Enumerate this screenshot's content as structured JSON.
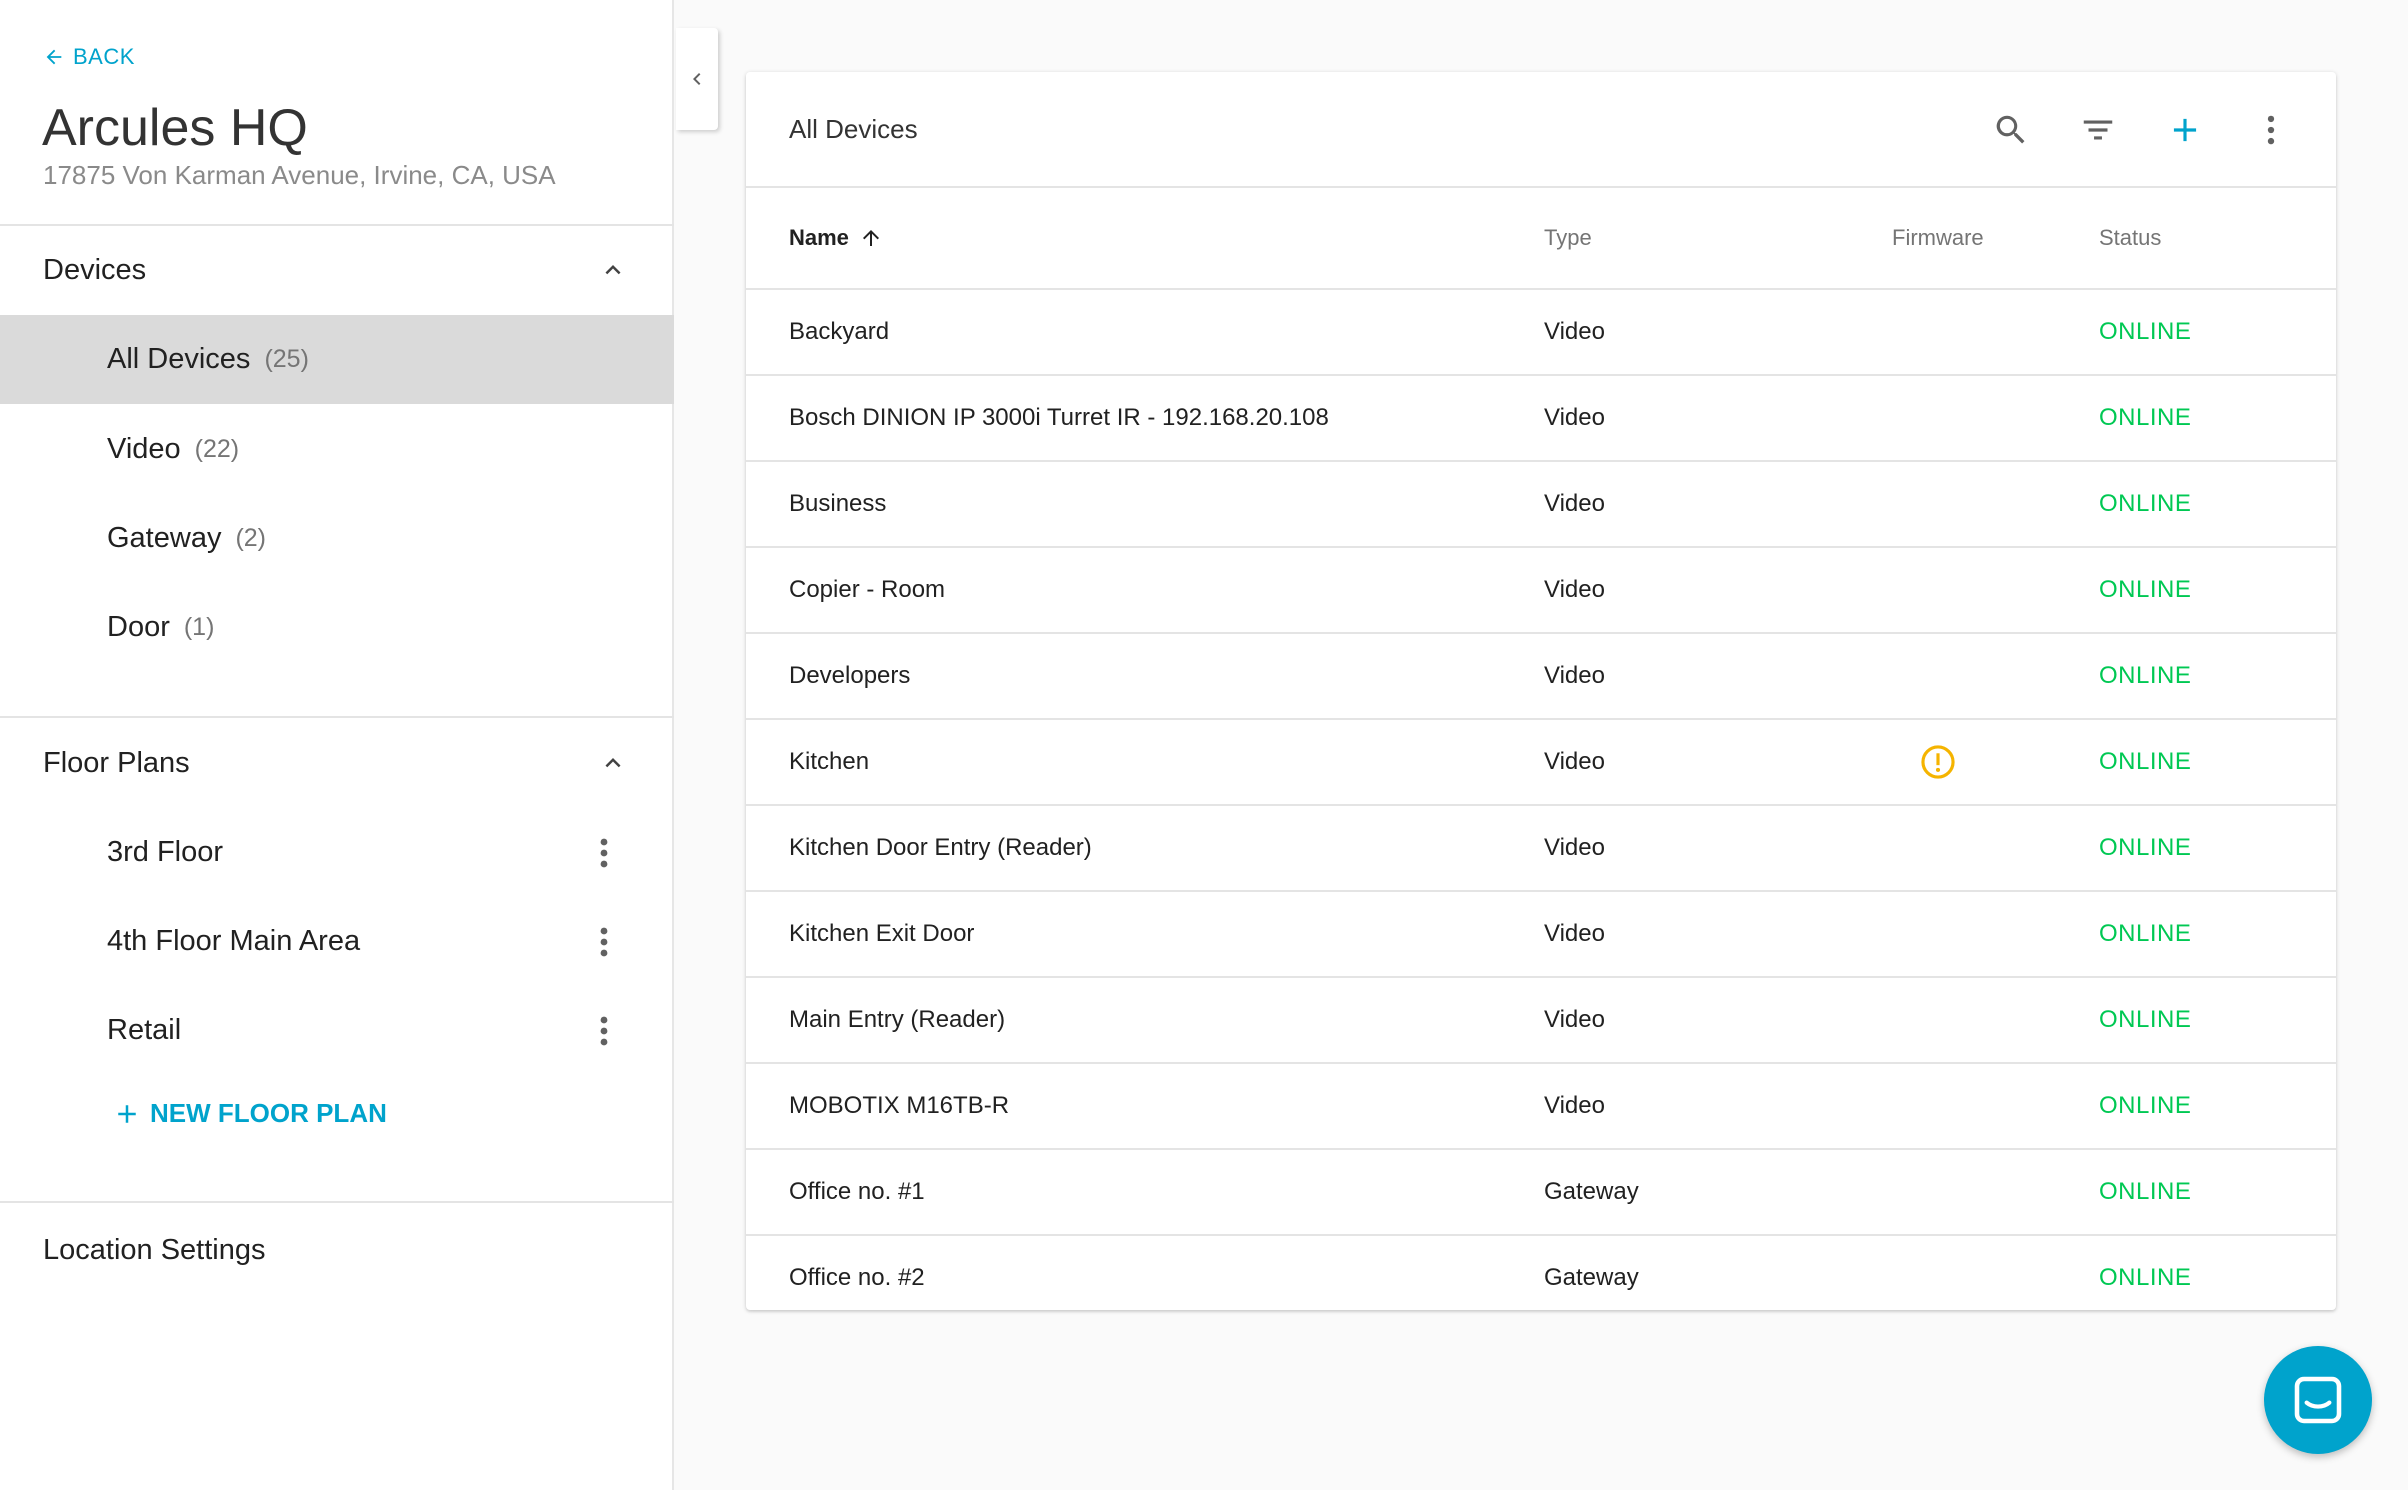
{
  "sidebar": {
    "back_label": "BACK",
    "location": {
      "title": "Arcules HQ",
      "address": "17875 Von Karman Avenue, Irvine, CA, USA"
    },
    "devices_section": {
      "label": "Devices",
      "items": [
        {
          "label": "All Devices",
          "count": "(25)",
          "active": true
        },
        {
          "label": "Video",
          "count": "(22)",
          "active": false
        },
        {
          "label": "Gateway",
          "count": "(2)",
          "active": false
        },
        {
          "label": "Door",
          "count": "(1)",
          "active": false
        }
      ]
    },
    "floor_plans_section": {
      "label": "Floor Plans",
      "items": [
        {
          "label": "3rd Floor"
        },
        {
          "label": "4th Floor Main Area"
        },
        {
          "label": "Retail"
        }
      ],
      "new_label": "NEW FLOOR PLAN"
    },
    "settings_label": "Location Settings"
  },
  "card": {
    "title": "All Devices",
    "toolbar": {
      "search_icon": "search-icon",
      "filter_icon": "filter-icon",
      "add_icon": "add-icon",
      "more_icon": "more-vert-icon"
    },
    "columns": {
      "name": "Name",
      "type": "Type",
      "firmware": "Firmware",
      "status": "Status"
    },
    "rows": [
      {
        "name": "Backyard",
        "type": "Video",
        "firmware_warning": false,
        "status": "ONLINE"
      },
      {
        "name": "Bosch DINION IP 3000i Turret IR - 192.168.20.108",
        "type": "Video",
        "firmware_warning": false,
        "status": "ONLINE"
      },
      {
        "name": "Business",
        "type": "Video",
        "firmware_warning": false,
        "status": "ONLINE"
      },
      {
        "name": "Copier - Room",
        "type": "Video",
        "firmware_warning": false,
        "status": "ONLINE"
      },
      {
        "name": "Developers",
        "type": "Video",
        "firmware_warning": false,
        "status": "ONLINE"
      },
      {
        "name": "Kitchen",
        "type": "Video",
        "firmware_warning": true,
        "status": "ONLINE"
      },
      {
        "name": "Kitchen Door Entry (Reader)",
        "type": "Video",
        "firmware_warning": false,
        "status": "ONLINE"
      },
      {
        "name": "Kitchen Exit Door",
        "type": "Video",
        "firmware_warning": false,
        "status": "ONLINE"
      },
      {
        "name": "Main Entry (Reader)",
        "type": "Video",
        "firmware_warning": false,
        "status": "ONLINE"
      },
      {
        "name": "MOBOTIX M16TB-R",
        "type": "Video",
        "firmware_warning": false,
        "status": "ONLINE"
      },
      {
        "name": "Office no. #1",
        "type": "Gateway",
        "firmware_warning": false,
        "status": "ONLINE"
      },
      {
        "name": "Office no. #2",
        "type": "Gateway",
        "firmware_warning": false,
        "status": "ONLINE"
      }
    ]
  },
  "colors": {
    "accent": "#00a3cc",
    "online": "#00c853",
    "warning": "#f5b400",
    "active_bg": "#dadada"
  }
}
